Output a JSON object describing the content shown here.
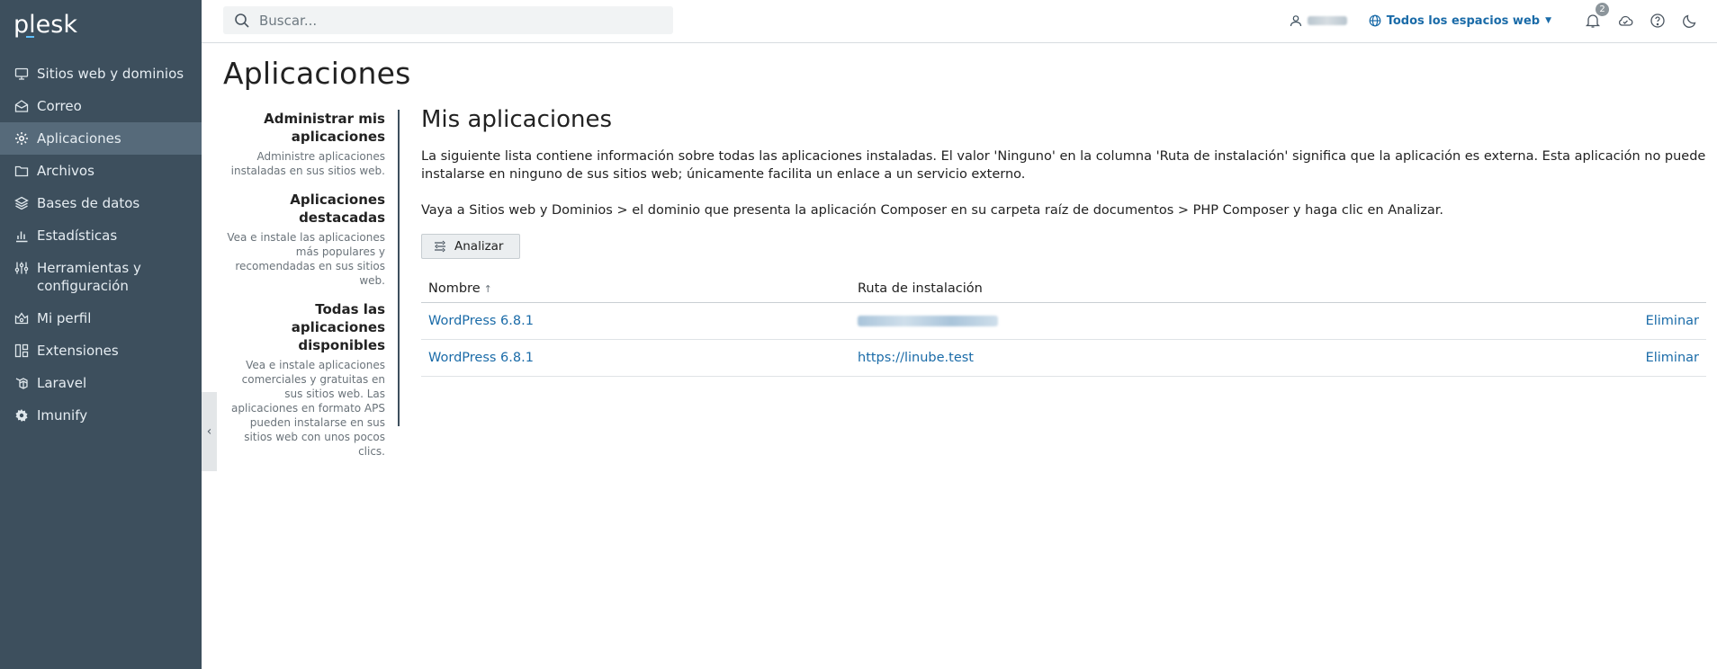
{
  "app": {
    "logo_text": "plesk"
  },
  "sidebar": {
    "items": [
      {
        "label": "Sitios web y dominios",
        "icon": "monitor-icon",
        "active": false
      },
      {
        "label": "Correo",
        "icon": "mail-icon",
        "active": false
      },
      {
        "label": "Aplicaciones",
        "icon": "gear-icon",
        "active": true
      },
      {
        "label": "Archivos",
        "icon": "folder-icon",
        "active": false
      },
      {
        "label": "Bases de datos",
        "icon": "layers-icon",
        "active": false
      },
      {
        "label": "Estadísticas",
        "icon": "bar-chart-icon",
        "active": false
      },
      {
        "label": "Herramientas y configuración",
        "icon": "tools-icon",
        "active": false
      },
      {
        "label": "Mi perfil",
        "icon": "profile-icon",
        "active": false
      },
      {
        "label": "Extensiones",
        "icon": "extensions-icon",
        "active": false
      },
      {
        "label": "Laravel",
        "icon": "laravel-icon",
        "active": false
      },
      {
        "label": "Imunify",
        "icon": "imunify-gear-icon",
        "active": false
      }
    ]
  },
  "topbar": {
    "search_placeholder": "Buscar...",
    "spaces_label": "Todos los espacios web",
    "notifications_count": "2"
  },
  "page": {
    "title": "Aplicaciones"
  },
  "subnav": {
    "sections": [
      {
        "title": "Administrar mis aplicaciones",
        "desc": "Administre aplicaciones instaladas en sus sitios web.",
        "active": true
      },
      {
        "title": "Aplicaciones destacadas",
        "desc": "Vea e instale las aplicaciones más populares y recomendadas en sus sitios web.",
        "active": false
      },
      {
        "title": "Todas las aplicaciones disponibles",
        "desc": "Vea e instale aplicaciones comerciales y gratuitas en sus sitios web. Las aplicaciones en formato APS pueden instalarse en sus sitios web con unos pocos clics.",
        "active": false
      }
    ]
  },
  "main": {
    "title": "Mis aplicaciones",
    "para1": "La siguiente lista contiene información sobre todas las aplicaciones instaladas. El valor 'Ninguno' en la columna 'Ruta de instalación' significa que la aplicación es externa. Esta aplicación no puede instalarse en ninguno de sus sitios web; únicamente facilita un enlace a un servicio externo.",
    "para2": "Vaya a Sitios web y Dominios > el dominio que presenta la aplicación Composer en su carpeta raíz de documentos > PHP Composer y haga clic en Analizar.",
    "analyze_button": "Analizar",
    "table": {
      "headers": {
        "name": "Nombre",
        "path": "Ruta de instalación"
      },
      "rows": [
        {
          "name": "WordPress 6.8.1",
          "path": "",
          "path_blurred": true,
          "action": "Eliminar"
        },
        {
          "name": "WordPress 6.8.1",
          "path": "https://linube.test",
          "path_blurred": false,
          "action": "Eliminar"
        }
      ]
    }
  },
  "colors": {
    "sidebar_bg": "#3d4f5d",
    "sidebar_active": "#566a7a",
    "link": "#1a6ba8"
  }
}
